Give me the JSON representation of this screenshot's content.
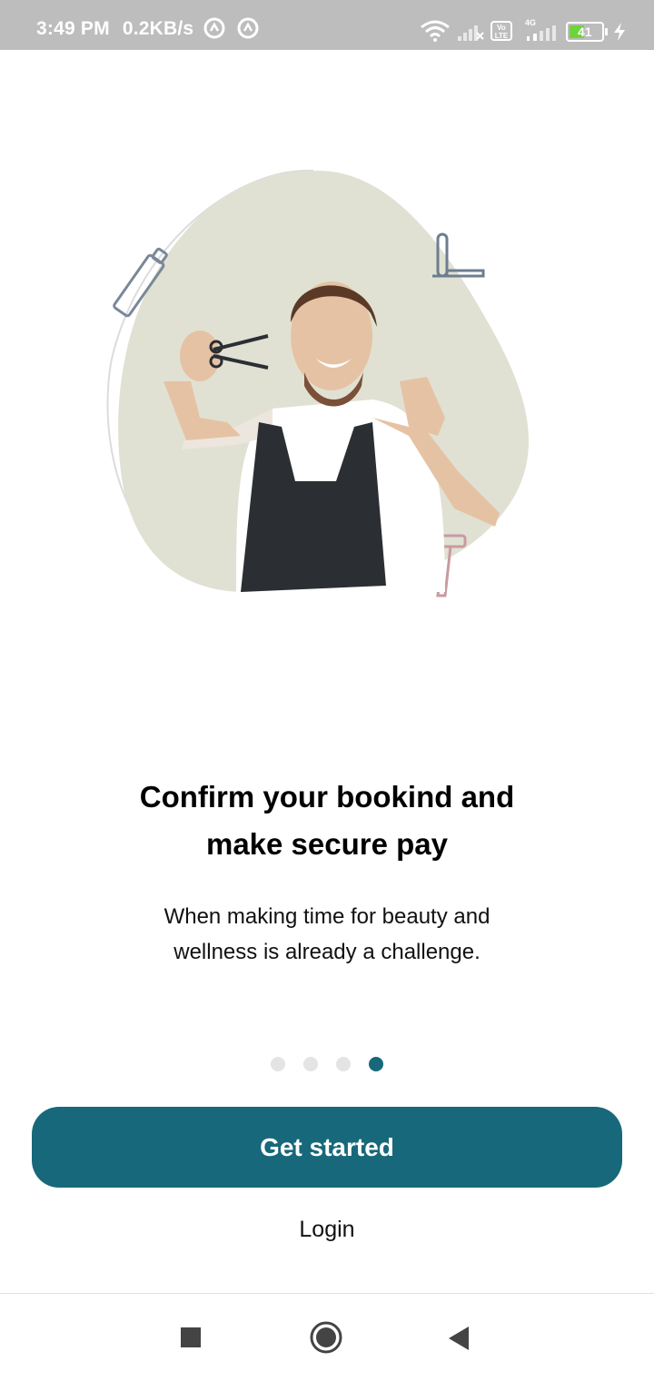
{
  "status_bar": {
    "time": "3:49 PM",
    "network_speed": "0.2KB/s",
    "battery_level": "41",
    "network_type": "4G",
    "volte_label": "Vo LTE",
    "icons": [
      "notification-circle-icon",
      "notification-circle-icon",
      "wifi-icon",
      "signal-icon",
      "volte-icon",
      "signal-icon",
      "battery-icon",
      "charging-icon"
    ]
  },
  "onboarding": {
    "headline_line1": "Confirm your bookind and",
    "headline_line2": "make secure pay",
    "body_line1": "When making time for beauty and",
    "body_line2": "wellness is already a challenge.",
    "page_count": 4,
    "active_page": 4
  },
  "actions": {
    "primary_label": "Get started",
    "secondary_label": "Login"
  },
  "colors": {
    "primary": "#17687a",
    "blob": "#e0e1d3",
    "dot_inactive": "#e4e4e4",
    "status_bar": "#bdbdbd"
  },
  "nav_bar": {
    "icons": [
      "recents-square-icon",
      "home-circle-icon",
      "back-triangle-icon"
    ]
  }
}
